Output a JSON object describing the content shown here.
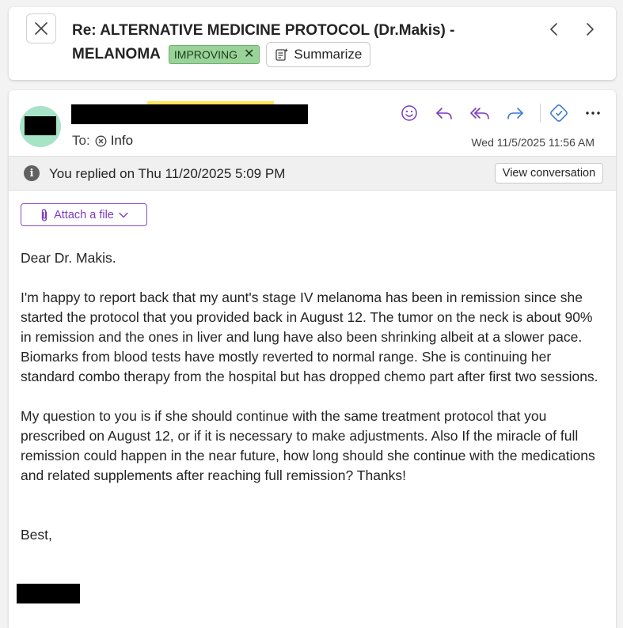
{
  "header": {
    "subject_line1": "Re: ALTERNATIVE MEDICINE PROTOCOL (Dr.Makis) -",
    "subject_line2": "MELANOMA",
    "tag_label": "IMPROVING",
    "tag_remove_glyph": "✕",
    "summarize_label": "Summarize",
    "close_icon": "close-icon",
    "prev_icon": "chevron-left-icon",
    "next_icon": "chevron-right-icon"
  },
  "message": {
    "to_label": "To:",
    "recipient": "Info",
    "date": "Wed 11/5/2025 11:56 AM",
    "actions": [
      "emoji-react",
      "reply",
      "reply-all",
      "forward",
      "copilot",
      "more"
    ],
    "info_text": "You replied on Thu 11/20/2025 5:09 PM",
    "view_conversation_label": "View conversation",
    "attach_label": "Attach a file",
    "greeting": "Dear Dr. Makis.",
    "paragraph1": "I'm happy to report back that my aunt's stage IV melanoma has been in remission since she started the protocol that you provided back in August 12.  The tumor on the neck is about 90% in remission and the ones in liver and lung have also been shrinking albeit at a slower pace. Biomarks from blood tests have mostly reverted to normal range.  She is continuing her standard combo therapy from the hospital but has dropped chemo part after first two sessions.",
    "paragraph2": "My question to you is if she should continue with the same treatment protocol that you prescribed on August 12, or if it is necessary to make adjustments.  Also If the miracle of full remission could happen in the near future, how long should she continue with the medications and related supplements after reaching full remission?    Thanks!",
    "closing": "Best,"
  },
  "colors": {
    "accent_purple": "#7a3bbd",
    "tag_green": "#9ad29a",
    "avatar": "#a6e3c7"
  }
}
